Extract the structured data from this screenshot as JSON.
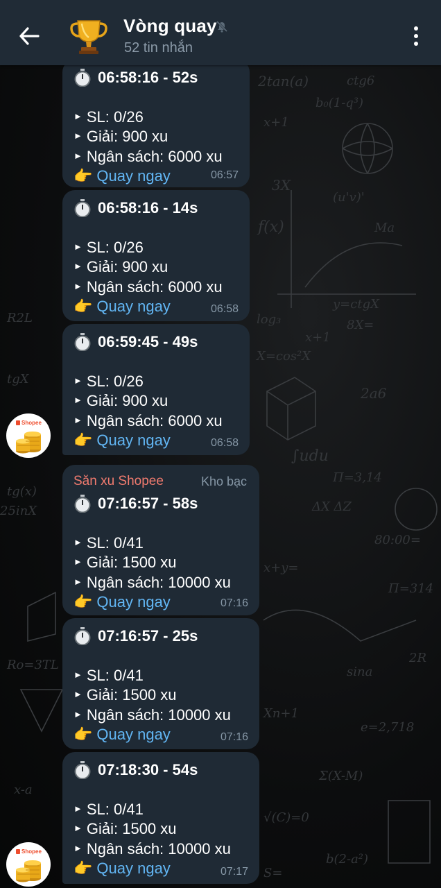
{
  "header": {
    "back_icon": "arrow-left-icon",
    "avatar_icon": "trophy-icon",
    "title": "Vòng quay",
    "muted_icon": "muted-bell-icon",
    "subtitle": "52 tin nhắn",
    "menu_icon": "more-vertical-icon"
  },
  "colors": {
    "header_bg": "#202b36",
    "bubble_bg": "#1f2a35",
    "link": "#62b6f4",
    "sender_name": "#f17b6f",
    "timestamp": "#8697a6"
  },
  "sender_avatar": {
    "label": "Shopee",
    "icon": "coin-stack-icon"
  },
  "messages": [
    {
      "timer": "06:58:16 - 52s",
      "sl": "SL: 0/26",
      "prize": "Giải: 900 xu",
      "budget": "Ngân sách: 6000 xu",
      "cta": "Quay ngay",
      "time": "06:57"
    },
    {
      "timer": "06:58:16 - 14s",
      "sl": "SL: 0/26",
      "prize": "Giải: 900 xu",
      "budget": "Ngân sách: 6000 xu",
      "cta": "Quay ngay",
      "time": "06:58"
    },
    {
      "timer": "06:59:45 - 49s",
      "sl": "SL: 0/26",
      "prize": "Giải: 900 xu",
      "budget": "Ngân sách: 6000 xu",
      "cta": "Quay ngay",
      "time": "06:58"
    },
    {
      "sender": "Săn xu Shopee",
      "badge": "Kho bạc",
      "timer": "07:16:57 - 58s",
      "sl": "SL: 0/41",
      "prize": "Giải: 1500 xu",
      "budget": "Ngân sách: 10000 xu",
      "cta": "Quay ngay",
      "time": "07:16"
    },
    {
      "timer": "07:16:57 - 25s",
      "sl": "SL: 0/41",
      "prize": "Giải: 1500 xu",
      "budget": "Ngân sách: 10000 xu",
      "cta": "Quay ngay",
      "time": "07:16"
    },
    {
      "timer": "07:18:30 - 54s",
      "sl": "SL: 0/41",
      "prize": "Giải: 1500 xu",
      "budget": "Ngân sách: 10000 xu",
      "cta": "Quay ngay",
      "time": "07:17"
    }
  ]
}
